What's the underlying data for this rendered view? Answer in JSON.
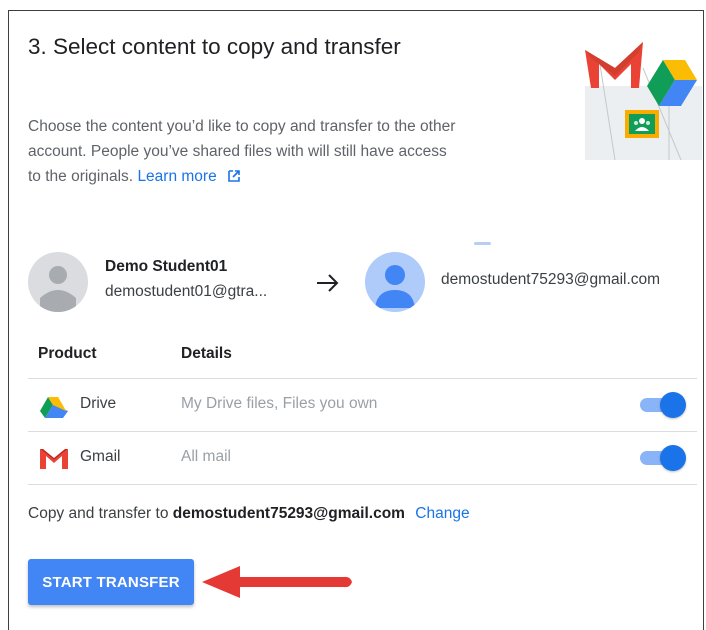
{
  "step": {
    "title": "3. Select content to copy and transfer",
    "description": "Choose the content you’d like to copy and transfer to the other account. People you’ve shared files with will still have access to the originals.",
    "learn_more": "Learn more"
  },
  "source_account": {
    "name": "Demo Student01",
    "email": "demostudent01@gtra..."
  },
  "destination_account": {
    "email": "demostudent75293@gmail.com"
  },
  "table": {
    "headers": {
      "product": "Product",
      "details": "Details"
    },
    "rows": [
      {
        "icon": "google-drive-icon",
        "product": "Drive",
        "details": "My Drive files, Files you own",
        "enabled": true
      },
      {
        "icon": "gmail-icon",
        "product": "Gmail",
        "details": "All mail",
        "enabled": true
      }
    ]
  },
  "summary": {
    "prefix": "Copy and transfer to",
    "email": "demostudent75293@gmail.com",
    "change": "Change"
  },
  "actions": {
    "start_transfer": "START TRANSFER"
  },
  "colors": {
    "accent": "#1a73e8",
    "button": "#4285f4",
    "callout_arrow": "#e53935"
  }
}
